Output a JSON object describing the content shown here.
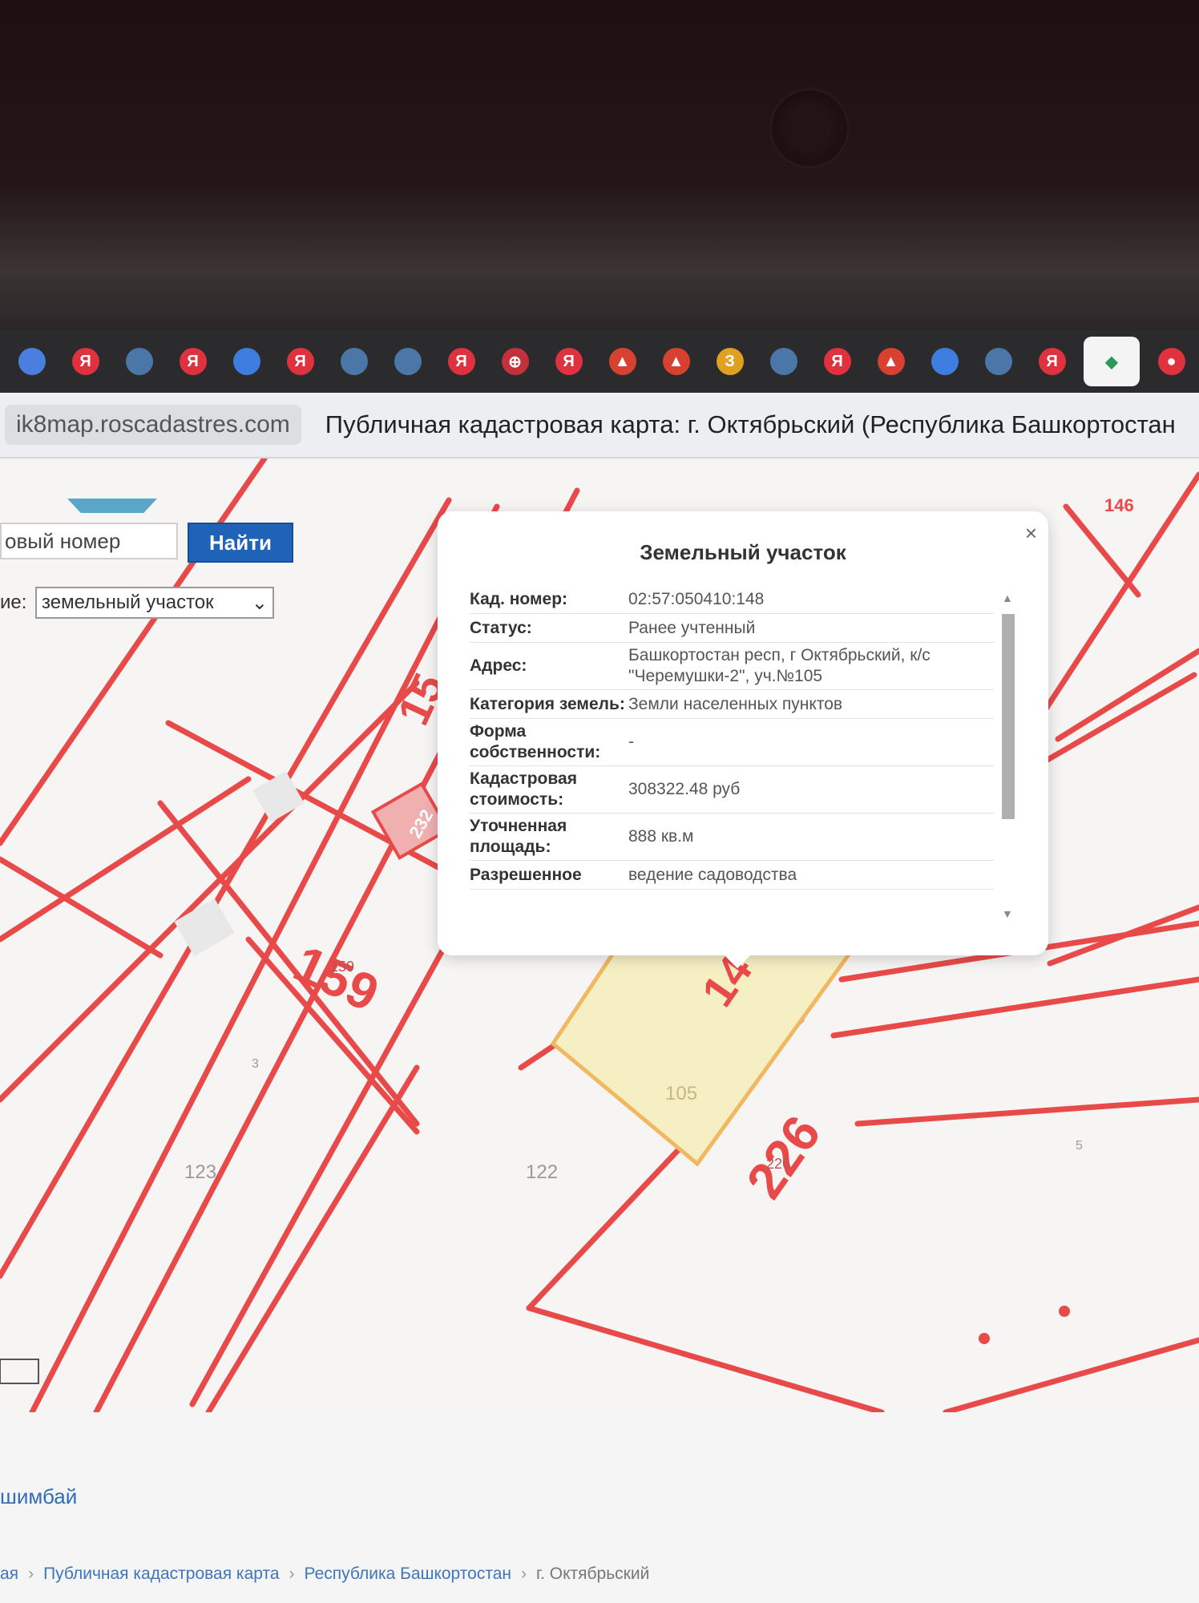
{
  "browser": {
    "url": "ik8map.roscadastres.com",
    "page_title": "Публичная кадастровая карта: г. Октябрьский (Республика Башкортостан",
    "tabs": [
      {
        "icon": "google-icon",
        "color": "#4a7fe0",
        "glyph": ""
      },
      {
        "icon": "yandex-icon",
        "color": "#e0323e",
        "glyph": "Я"
      },
      {
        "icon": "vk-icon",
        "color": "#4a76a8",
        "glyph": ""
      },
      {
        "icon": "yandex-icon",
        "color": "#e0323e",
        "glyph": "Я"
      },
      {
        "icon": "ozon-icon",
        "color": "#3d7de0",
        "glyph": ""
      },
      {
        "icon": "yandex-icon",
        "color": "#e0323e",
        "glyph": "Я"
      },
      {
        "icon": "vk-icon",
        "color": "#4a76a8",
        "glyph": ""
      },
      {
        "icon": "vk-icon",
        "color": "#4a76a8",
        "glyph": ""
      },
      {
        "icon": "yandex-icon",
        "color": "#e0323e",
        "glyph": "Я"
      },
      {
        "icon": "avito-icon",
        "color": "#c4313a",
        "glyph": "⊕"
      },
      {
        "icon": "yandex-icon",
        "color": "#e0323e",
        "glyph": "Я"
      },
      {
        "icon": "mountain-icon",
        "color": "#d8412f",
        "glyph": "▲"
      },
      {
        "icon": "mountain-icon",
        "color": "#d8412f",
        "glyph": "▲"
      },
      {
        "icon": "zen-icon",
        "color": "#e0a020",
        "glyph": "З"
      },
      {
        "icon": "vk-icon",
        "color": "#4a76a8",
        "glyph": ""
      },
      {
        "icon": "yandex-icon",
        "color": "#e0323e",
        "glyph": "Я"
      },
      {
        "icon": "mountain-icon",
        "color": "#d8412f",
        "glyph": "▲"
      },
      {
        "icon": "ozon-icon",
        "color": "#3d7de0",
        "glyph": ""
      },
      {
        "icon": "vk-icon",
        "color": "#4a76a8",
        "glyph": ""
      },
      {
        "icon": "yandex-icon",
        "color": "#e0323e",
        "glyph": "Я"
      },
      {
        "icon": "cadastre-icon",
        "color": "#2a9a5a",
        "glyph": "◆",
        "active": true
      },
      {
        "icon": "map-pin-icon",
        "color": "#e0323e",
        "glyph": "●"
      }
    ]
  },
  "search": {
    "input_value": "овый номер",
    "button_label": "Найти",
    "select_label": "ие:",
    "select_value": "земельный участок"
  },
  "popup": {
    "title": "Земельный участок",
    "close": "×",
    "rows": [
      {
        "key": "Кад. номер:",
        "value": "02:57:050410:148"
      },
      {
        "key": "Статус:",
        "value": "Ранее учтенный"
      },
      {
        "key": "Адрес:",
        "value": "Башкортостан респ, г Октябрьский, к/с \"Черемушки-2\", уч.№105"
      },
      {
        "key": "Категория земель:",
        "value": "Земли населенных пунктов"
      },
      {
        "key": "Форма собственности:",
        "value": "-"
      },
      {
        "key": "Кадастровая стоимость:",
        "value": "308322.48 руб"
      },
      {
        "key": "Уточненная площадь:",
        "value": "888 кв.м"
      },
      {
        "key": "Разрешенное",
        "value": "ведение садоводства"
      }
    ]
  },
  "map": {
    "labels": {
      "l159": "159",
      "l159s": "159",
      "l226": "226",
      "l226s": "226",
      "l122": "122",
      "l123": "123",
      "l105": "105",
      "l3": "3",
      "l5": "5",
      "l15": "15",
      "l232": "232",
      "l146": "146",
      "l14": "14"
    },
    "colors": {
      "parcel_line": "#e84a4a",
      "selected_fill": "#f6efc4",
      "selected_stroke": "#f0b860"
    }
  },
  "footer": {
    "district": "шимбай",
    "breadcrumb": [
      "ая",
      "Публичная кадастровая карта",
      "Республика Башкортостан",
      "г. Октябрьский"
    ]
  }
}
